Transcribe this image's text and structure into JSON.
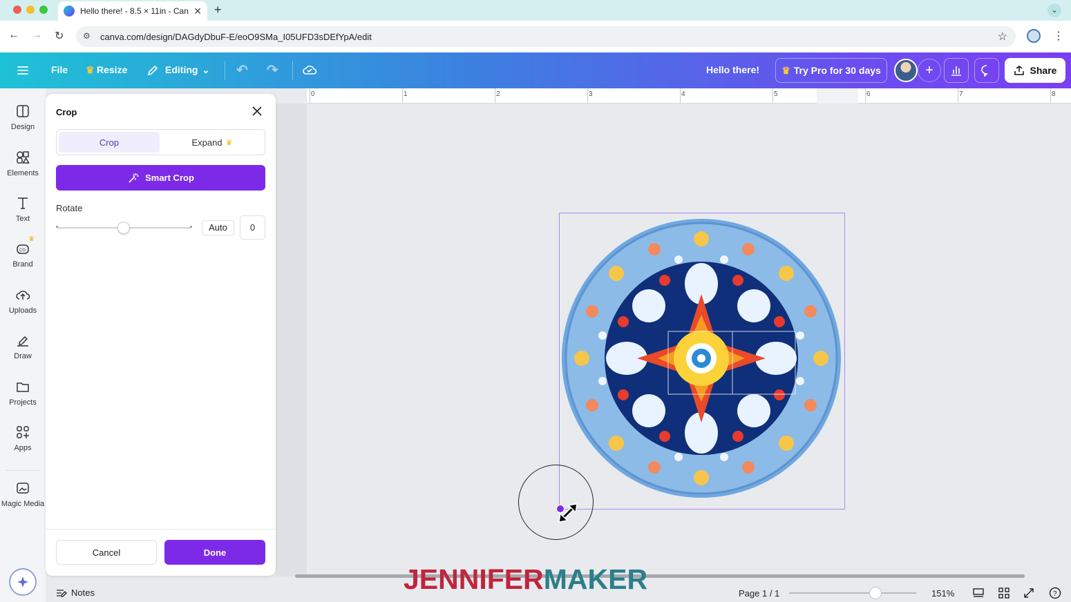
{
  "browser": {
    "tab_title": "Hello there! - 8.5 × 11in - Can",
    "url": "canva.com/design/DAGdyDbuF-E/eoO9SMa_I05UFD3sDEfYpA/edit",
    "traffic_colors": [
      "#ee5f57",
      "#f5be2e",
      "#38c844"
    ]
  },
  "header": {
    "file_label": "File",
    "resize_label": "Resize",
    "editing_label": "Editing",
    "design_title": "Hello there!",
    "trypro_label": "Try Pro for 30 days",
    "share_label": "Share"
  },
  "rail": {
    "items": [
      {
        "label": "Design",
        "icon": "design-icon"
      },
      {
        "label": "Elements",
        "icon": "elements-icon"
      },
      {
        "label": "Text",
        "icon": "text-icon"
      },
      {
        "label": "Brand",
        "icon": "brand-icon"
      },
      {
        "label": "Uploads",
        "icon": "uploads-icon"
      },
      {
        "label": "Draw",
        "icon": "draw-icon"
      },
      {
        "label": "Projects",
        "icon": "projects-icon"
      },
      {
        "label": "Apps",
        "icon": "apps-icon"
      },
      {
        "label": "Magic Media",
        "icon": "magic-media-icon"
      }
    ]
  },
  "panel": {
    "title": "Crop",
    "tabs": {
      "crop": "Crop",
      "expand": "Expand"
    },
    "smart_crop_label": "Smart Crop",
    "rotate_label": "Rotate",
    "auto_label": "Auto",
    "rotate_value": "0",
    "cancel_label": "Cancel",
    "done_label": "Done"
  },
  "ruler": {
    "ticks": [
      "0",
      "1",
      "2",
      "3",
      "4",
      "5",
      "6",
      "7",
      "8"
    ]
  },
  "footer": {
    "notes_label": "Notes",
    "page_label": "Page 1 / 1",
    "zoom_label": "151%",
    "watermark_a": "JENNIFER",
    "watermark_b": "MAKER"
  },
  "colors": {
    "accent": "#7d2ae8",
    "selection": "#a88cf0",
    "watermark_red": "#c0253d",
    "watermark_teal": "#2c7f8a"
  }
}
